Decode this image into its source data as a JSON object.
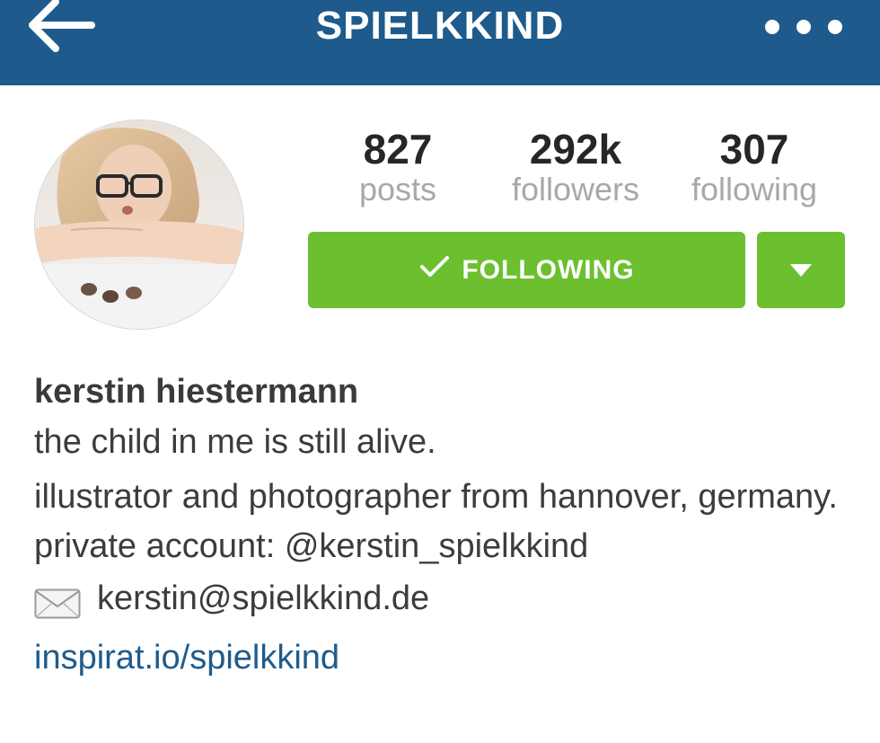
{
  "header": {
    "title": "SPIELKKIND",
    "back_icon": "arrow-left-icon",
    "more_icon": "more-dots-icon",
    "background_color": "#1e5b8c"
  },
  "profile": {
    "avatar_icon": "profile-avatar"
  },
  "stats": {
    "posts": {
      "value": "827",
      "label": "posts"
    },
    "followers": {
      "value": "292k",
      "label": "followers"
    },
    "following": {
      "value": "307",
      "label": "following"
    }
  },
  "actions": {
    "follow_label": "FOLLOWING",
    "follow_icon": "check-icon",
    "dropdown_icon": "caret-down-icon",
    "button_color": "#6cbf2e"
  },
  "bio": {
    "name": "kerstin hiestermann",
    "tagline": "the child in me is still alive.",
    "description": "illustrator and photographer from hannover, germany. private account: @kerstin_spielkkind",
    "email_icon": "envelope-icon",
    "email": "kerstin@spielkkind.de",
    "link": "inspirat.io/spielkkind",
    "link_color": "#1e5b8c"
  }
}
